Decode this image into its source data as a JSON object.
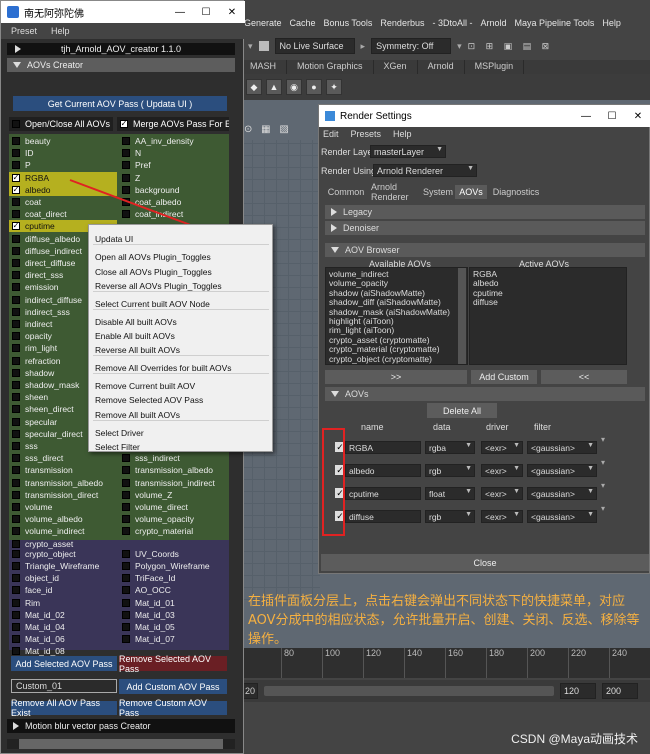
{
  "maya": {
    "menu": [
      "Generate",
      "Cache",
      "Bonus Tools",
      "Renderbus",
      "- 3DtoAll -",
      "Arnold",
      "Maya Pipeline Tools",
      "Help"
    ],
    "live_surface": "No Live Surface",
    "symmetry": "Symmetry: Off",
    "shelf_tabs": [
      "MASH",
      "Motion Graphics",
      "XGen",
      "Arnold",
      "MSPlugin"
    ],
    "timeline_ticks": [
      "",
      "80",
      "100",
      "120",
      "140",
      "160",
      "180",
      "200",
      "220",
      "240"
    ],
    "range_start": "20",
    "range_end": "120",
    "range_end2": "200"
  },
  "tool": {
    "title": "南无阿弥陀佛",
    "menu": [
      "Preset",
      "Help"
    ],
    "header": "tjh_Arnold_AOV_creator 1.1.0",
    "collapsed_row": "?",
    "section": "AOVs Creator",
    "get_button": "Get Current AOV Pass ( Updata UI )",
    "open_close": "Open/Close All AOVs",
    "merge": "Merge AOVs Pass For EXR",
    "aovs_left_green": [
      {
        "label": "beauty",
        "checked": false
      },
      {
        "label": "ID",
        "checked": false
      },
      {
        "label": "P",
        "checked": false
      },
      {
        "label": "RGBA",
        "checked": true,
        "highlight": true
      },
      {
        "label": "albedo",
        "checked": true,
        "highlight": true
      },
      {
        "label": "coat",
        "checked": false
      },
      {
        "label": "coat_direct",
        "checked": false
      },
      {
        "label": "cputime",
        "checked": true,
        "highlight": true
      },
      {
        "label": "diffuse_albedo",
        "checked": false
      },
      {
        "label": "diffuse_indirect",
        "checked": false
      },
      {
        "label": "direct_diffuse",
        "checked": false
      },
      {
        "label": "direct_sss",
        "checked": false
      },
      {
        "label": "emission",
        "checked": false
      },
      {
        "label": "indirect_diffuse",
        "checked": false
      },
      {
        "label": "indirect_sss",
        "checked": false
      },
      {
        "label": "indirect",
        "checked": false
      },
      {
        "label": "opacity",
        "checked": false
      },
      {
        "label": "rim_light",
        "checked": false
      },
      {
        "label": "refraction",
        "checked": false
      },
      {
        "label": "shadow",
        "checked": false
      },
      {
        "label": "shadow_mask",
        "checked": false
      },
      {
        "label": "sheen",
        "checked": false
      },
      {
        "label": "sheen_direct",
        "checked": false
      },
      {
        "label": "specular",
        "checked": false
      },
      {
        "label": "specular_direct",
        "checked": false
      },
      {
        "label": "sss",
        "checked": false
      },
      {
        "label": "sss_direct",
        "checked": false
      },
      {
        "label": "transmission",
        "checked": false
      },
      {
        "label": "transmission_albedo",
        "checked": false
      },
      {
        "label": "transmission_direct",
        "checked": false
      },
      {
        "label": "volume",
        "checked": false
      },
      {
        "label": "volume_albedo",
        "checked": false
      },
      {
        "label": "volume_indirect",
        "checked": false
      },
      {
        "label": "crypto_asset",
        "checked": false
      }
    ],
    "aovs_right_green": [
      {
        "label": "AA_inv_density",
        "row": 0
      },
      {
        "label": "N",
        "row": 1
      },
      {
        "label": "Pref",
        "row": 2
      },
      {
        "label": "Z",
        "row": 3
      },
      {
        "label": "background",
        "row": 4
      },
      {
        "label": "coat_albedo",
        "row": 5
      },
      {
        "label": "coat_indirect",
        "row": 6
      },
      {
        "label": "sss_indirect",
        "row": 26
      },
      {
        "label": "transmission_albedo",
        "row": 27
      },
      {
        "label": "transmission_indirect",
        "row": 28
      },
      {
        "label": "volume_Z",
        "row": 29
      },
      {
        "label": "volume_direct",
        "row": 30
      },
      {
        "label": "volume_opacity",
        "row": 31
      },
      {
        "label": "crypto_material",
        "row": 32
      }
    ],
    "aovs_left_purple": [
      "crypto_object",
      "Triangle_Wireframe",
      "object_id",
      "face_id",
      "Rim",
      "Mat_id_02",
      "Mat_id_04",
      "Mat_id_06",
      "Mat_id_08"
    ],
    "aovs_right_purple": [
      "UV_Coords",
      "Polygon_Wireframe",
      "TriFace_Id",
      "AO_OCC",
      "Mat_id_01",
      "Mat_id_03",
      "Mat_id_05",
      "Mat_id_07"
    ],
    "add_selected": "Add Selected AOV Pass",
    "remove_selected": "Remove Selected AOV Pass",
    "custom_value": "Custom_01",
    "add_custom": "Add Custom AOV Pass",
    "remove_all_exist": "Remove All AOV Pass Exist",
    "remove_custom": "Remove Custom AOV Pass",
    "motion_blur": "Motion blur vector pass Creator"
  },
  "context_menu": {
    "items": [
      "Updata UI",
      "Open all AOVs Plugin_Toggles",
      "Close all AOVs Plugin_Toggles",
      "Reverse all AOVs Plugin_Toggles",
      "Select Current built AOV Node",
      "Disable All built AOVs",
      "Enable All built AOVs",
      "Reverse All built AOVs",
      "Remove All Overrides for built AOVs",
      "Remove Current built AOV",
      "Remove Selected AOV Pass",
      "Remove All built AOVs",
      "Select Driver",
      "Select Filter"
    ]
  },
  "render_settings": {
    "title": "Render Settings",
    "menu": [
      "Edit",
      "Presets",
      "Help"
    ],
    "render_layer_label": "Render Layer",
    "render_layer": "masterLayer",
    "render_using_label": "Render Using",
    "render_using": "Arnold Renderer",
    "tabs": [
      "Common",
      "Arnold Renderer",
      "System",
      "AOVs",
      "Diagnostics"
    ],
    "active_tab": "AOVs",
    "sections": [
      "Legacy",
      "Denoiser",
      "AOV Browser",
      "AOVs"
    ],
    "available_header": "Available AOVs",
    "active_header": "Active AOVs",
    "available": [
      "volume_indirect",
      "volume_opacity",
      "shadow (aiShadowMatte)",
      "shadow_diff (aiShadowMatte)",
      "shadow_mask (aiShadowMatte)",
      "highlight (aiToon)",
      "rim_light (aiToon)",
      "crypto_asset (cryptomatte)",
      "crypto_material (cryptomatte)",
      "crypto_object (cryptomatte)"
    ],
    "active": [
      "RGBA",
      "albedo",
      "cputime",
      "diffuse"
    ],
    "move_right": ">>",
    "add_custom": "Add Custom",
    "move_left": "<<",
    "delete_all": "Delete All",
    "col_name": "name",
    "col_data": "data",
    "col_driver": "driver",
    "col_filter": "filter",
    "rows": [
      {
        "name": "RGBA",
        "data": "rgba",
        "driver": "<exr>",
        "filter": "<gaussian>"
      },
      {
        "name": "albedo",
        "data": "rgb",
        "driver": "<exr>",
        "filter": "<gaussian>"
      },
      {
        "name": "cputime",
        "data": "float",
        "driver": "<exr>",
        "filter": "<gaussian>"
      },
      {
        "name": "diffuse",
        "data": "rgb",
        "driver": "<exr>",
        "filter": "<gaussian>"
      }
    ],
    "close": "Close"
  },
  "caption": "在插件面板分层上，点击右键会弹出不同状态下的快捷菜单，对应AOV分成中的相应状态，允许批量开启、创建、关闭、反选、移除等操作。",
  "watermark": "CSDN @Maya动画技术",
  "colors": {
    "highlight": "#b5b01f",
    "green_grid": "#3e5a33",
    "purple_grid": "#3a3558",
    "blue_button": "#2b4e7e",
    "red_button": "#6a1f24",
    "caption": "#f5b041",
    "annotation": "#e02222"
  }
}
